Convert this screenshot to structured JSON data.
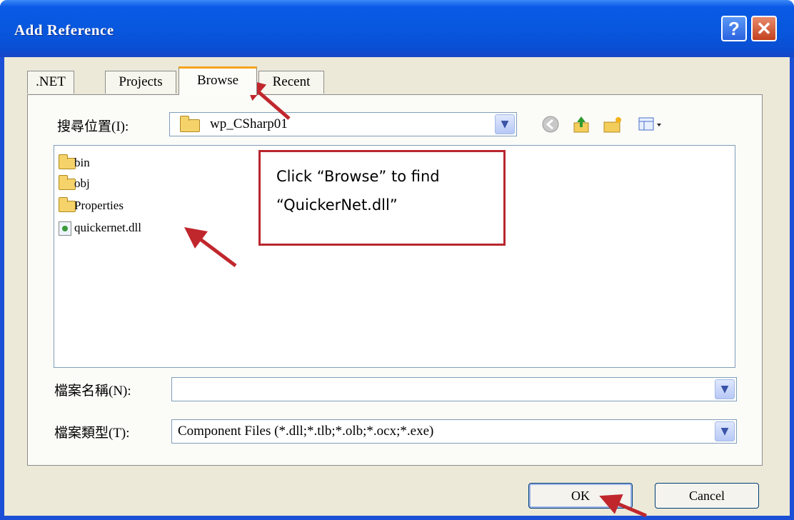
{
  "window": {
    "title": "Add Reference",
    "help_glyph": "?",
    "close_glyph": "✕"
  },
  "tabs": [
    {
      "label": ".NET"
    },
    {
      "label": "Projects"
    },
    {
      "label": "Browse",
      "active": true
    },
    {
      "label": "Recent"
    }
  ],
  "lookin": {
    "label": "搜尋位置(I):",
    "value": "wp_CSharp01"
  },
  "toolbar_icons": [
    "back-icon",
    "up-folder-icon",
    "new-folder-icon",
    "view-menu-icon"
  ],
  "files": [
    {
      "name": "bin",
      "icon": "folder-icon"
    },
    {
      "name": "obj",
      "icon": "folder-icon"
    },
    {
      "name": "Properties",
      "icon": "folder-icon"
    },
    {
      "name": "quickernet.dll",
      "icon": "dll-file-icon"
    }
  ],
  "filename": {
    "label": "檔案名稱(N):",
    "value": ""
  },
  "filetype": {
    "label": "檔案類型(T):",
    "value": "Component Files (*.dll;*.tlb;*.olb;*.ocx;*.exe)"
  },
  "buttons": {
    "ok": "OK",
    "cancel": "Cancel"
  },
  "annotation": {
    "line1": "Click “Browse” to find",
    "line2": "“QuickerNet.dll”",
    "border_color": "#b8262e",
    "arrow_color": "#c0272d"
  },
  "colors": {
    "titlebar": "#0a5ae6",
    "dialog_bg": "#ece9d8",
    "active_tab_accent": "#f7a41c"
  }
}
